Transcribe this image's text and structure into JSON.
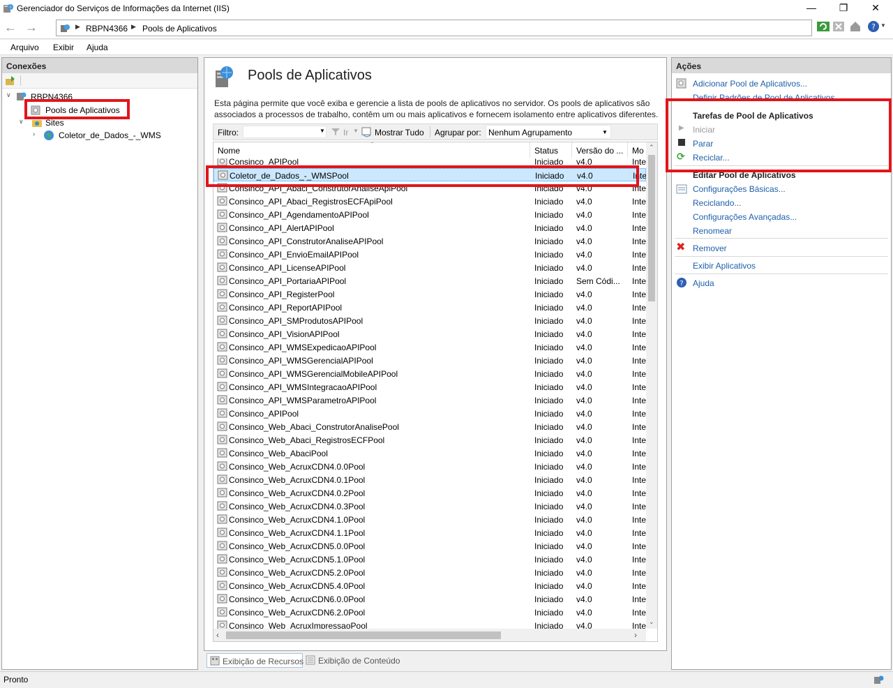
{
  "window": {
    "title": "Gerenciador do Serviços de Informações da Internet (IIS)"
  },
  "address": {
    "crumbs": [
      "RBPN4366",
      "Pools de Aplicativos"
    ]
  },
  "menu": [
    "Arquivo",
    "Exibir",
    "Ajuda"
  ],
  "connections": {
    "title": "Conexões",
    "server": "RBPN4366",
    "app_pools": "Pools de Aplicativos",
    "sites": "Sites",
    "site": "Coletor_de_Dados_-_WMS"
  },
  "main": {
    "title": "Pools de Aplicativos",
    "description": "Esta página permite que você exiba e gerencie a lista de pools de aplicativos no servidor. Os pools de aplicativos são associados a processos de trabalho, contêm um ou mais aplicativos e fornecem isolamento entre aplicativos diferentes.",
    "filter_label": "Filtro:",
    "go_label": "Ir",
    "show_all_label": "Mostrar Tudo",
    "group_by_label": "Agrupar por:",
    "group_by_value": "Nenhum Agrupamento",
    "columns": [
      "Nome",
      "Status",
      "Versão do ...",
      "Mo"
    ],
    "rows": [
      [
        "Consinco_APIPool",
        "Iniciado",
        "v4.0",
        "Inte"
      ],
      [
        "Coletor_de_Dados_-_WMSPool",
        "Iniciado",
        "v4.0",
        "Inte"
      ],
      [
        "Consinco_API_Abaci_ConstrutorAnaliseApiPool",
        "Iniciado",
        "v4.0",
        "Inte"
      ],
      [
        "Consinco_API_Abaci_RegistrosECFApiPool",
        "Iniciado",
        "v4.0",
        "Inte"
      ],
      [
        "Consinco_API_AgendamentoAPIPool",
        "Iniciado",
        "v4.0",
        "Inte"
      ],
      [
        "Consinco_API_AlertAPIPool",
        "Iniciado",
        "v4.0",
        "Inte"
      ],
      [
        "Consinco_API_ConstrutorAnaliseAPIPool",
        "Iniciado",
        "v4.0",
        "Inte"
      ],
      [
        "Consinco_API_EnvioEmailAPIPool",
        "Iniciado",
        "v4.0",
        "Inte"
      ],
      [
        "Consinco_API_LicenseAPIPool",
        "Iniciado",
        "v4.0",
        "Inte"
      ],
      [
        "Consinco_API_PortariaAPIPool",
        "Iniciado",
        "Sem Códi...",
        "Inte"
      ],
      [
        "Consinco_API_RegisterPool",
        "Iniciado",
        "v4.0",
        "Inte"
      ],
      [
        "Consinco_API_ReportAPIPool",
        "Iniciado",
        "v4.0",
        "Inte"
      ],
      [
        "Consinco_API_SMProdutosAPIPool",
        "Iniciado",
        "v4.0",
        "Inte"
      ],
      [
        "Consinco_API_VisionAPIPool",
        "Iniciado",
        "v4.0",
        "Inte"
      ],
      [
        "Consinco_API_WMSExpedicaoAPIPool",
        "Iniciado",
        "v4.0",
        "Inte"
      ],
      [
        "Consinco_API_WMSGerencialAPIPool",
        "Iniciado",
        "v4.0",
        "Inte"
      ],
      [
        "Consinco_API_WMSGerencialMobileAPIPool",
        "Iniciado",
        "v4.0",
        "Inte"
      ],
      [
        "Consinco_API_WMSIntegracaoAPIPool",
        "Iniciado",
        "v4.0",
        "Inte"
      ],
      [
        "Consinco_API_WMSParametroAPIPool",
        "Iniciado",
        "v4.0",
        "Inte"
      ],
      [
        "Consinco_APIPool",
        "Iniciado",
        "v4.0",
        "Inte"
      ],
      [
        "Consinco_Web_Abaci_ConstrutorAnalisePool",
        "Iniciado",
        "v4.0",
        "Inte"
      ],
      [
        "Consinco_Web_Abaci_RegistrosECFPool",
        "Iniciado",
        "v4.0",
        "Inte"
      ],
      [
        "Consinco_Web_AbaciPool",
        "Iniciado",
        "v4.0",
        "Inte"
      ],
      [
        "Consinco_Web_AcruxCDN4.0.0Pool",
        "Iniciado",
        "v4.0",
        "Inte"
      ],
      [
        "Consinco_Web_AcruxCDN4.0.1Pool",
        "Iniciado",
        "v4.0",
        "Inte"
      ],
      [
        "Consinco_Web_AcruxCDN4.0.2Pool",
        "Iniciado",
        "v4.0",
        "Inte"
      ],
      [
        "Consinco_Web_AcruxCDN4.0.3Pool",
        "Iniciado",
        "v4.0",
        "Inte"
      ],
      [
        "Consinco_Web_AcruxCDN4.1.0Pool",
        "Iniciado",
        "v4.0",
        "Inte"
      ],
      [
        "Consinco_Web_AcruxCDN4.1.1Pool",
        "Iniciado",
        "v4.0",
        "Inte"
      ],
      [
        "Consinco_Web_AcruxCDN5.0.0Pool",
        "Iniciado",
        "v4.0",
        "Inte"
      ],
      [
        "Consinco_Web_AcruxCDN5.1.0Pool",
        "Iniciado",
        "v4.0",
        "Inte"
      ],
      [
        "Consinco_Web_AcruxCDN5.2.0Pool",
        "Iniciado",
        "v4.0",
        "Inte"
      ],
      [
        "Consinco_Web_AcruxCDN5.4.0Pool",
        "Iniciado",
        "v4.0",
        "Inte"
      ],
      [
        "Consinco_Web_AcruxCDN6.0.0Pool",
        "Iniciado",
        "v4.0",
        "Inte"
      ],
      [
        "Consinco_Web_AcruxCDN6.2.0Pool",
        "Iniciado",
        "v4.0",
        "Inte"
      ],
      [
        "Consinco_Web_AcruxImpressaoPool",
        "Iniciado",
        "v4.0",
        "Inte"
      ]
    ],
    "selected_row": 1
  },
  "actions": {
    "title": "Ações",
    "add_pool": "Adicionar Pool de Aplicativos...",
    "set_defaults": "Definir Padrões de Pool de Aplicativos...",
    "tasks_header": "Tarefas de Pool de Aplicativos",
    "start": "Iniciar",
    "stop": "Parar",
    "recycle": "Reciclar...",
    "edit_header": "Editar Pool de Aplicativos",
    "basic_settings": "Configurações Básicas...",
    "recycling": "Reciclando...",
    "advanced_settings": "Configurações Avançadas...",
    "rename": "Renomear",
    "remove": "Remover",
    "view_apps": "Exibir Aplicativos",
    "help": "Ajuda"
  },
  "bottom_tabs": [
    "Exibição de Recursos",
    "Exibição de Conteúdo"
  ],
  "status": "Pronto",
  "colors": {
    "highlight": "#e0161b",
    "link": "#1e5fa8",
    "selection": "#cce8ff"
  }
}
